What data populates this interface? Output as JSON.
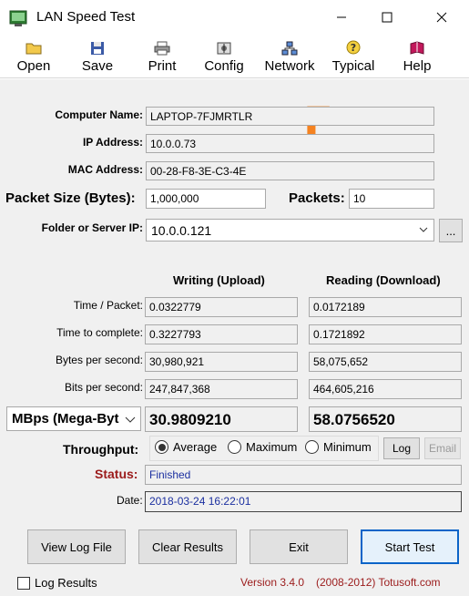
{
  "window": {
    "title": "LAN Speed Test",
    "minimize_glyph": "—",
    "maximize_glyph": "☐",
    "close_glyph": "✕"
  },
  "toolbar": [
    {
      "label": "Open",
      "icon": "open-folder-icon"
    },
    {
      "label": "Save",
      "icon": "save-disk-icon"
    },
    {
      "label": "Print",
      "icon": "printer-icon"
    },
    {
      "label": "Config",
      "icon": "config-icon"
    },
    {
      "label": "Network",
      "icon": "network-icon"
    },
    {
      "label": "Typical",
      "icon": "help-question-icon"
    },
    {
      "label": "Help",
      "icon": "help-book-icon"
    }
  ],
  "info": {
    "computer_name_label": "Computer Name:",
    "computer_name": "LAPTOP-7FJMRTLR",
    "ip_label": "IP Address:",
    "ip": "10.0.0.73",
    "mac_label": "MAC Address:",
    "mac": "00-28-F8-3E-C3-4E",
    "packet_size_label": "Packet Size (Bytes):",
    "packet_size": "1,000,000",
    "packets_label": "Packets:",
    "packets": "10",
    "folder_label": "Folder or Server IP:",
    "folder_value": "10.0.0.121",
    "browse_label": "..."
  },
  "watermark_letter": "F",
  "results": {
    "writing_header": "Writing (Upload)",
    "reading_header": "Reading (Download)",
    "rows": [
      {
        "label": "Time / Packet:",
        "write": "0.0322779",
        "read": "0.0172189"
      },
      {
        "label": "Time to complete:",
        "write": "0.3227793",
        "read": "0.1721892"
      },
      {
        "label": "Bytes per second:",
        "write": "30,980,921",
        "read": "58,075,652"
      },
      {
        "label": "Bits per second:",
        "write": "247,847,368",
        "read": "464,605,216"
      }
    ],
    "unit_select": "MBps (Mega-Byt",
    "mbps_write": "30.9809210",
    "mbps_read": "58.0756520"
  },
  "throughput": {
    "label": "Throughput:",
    "options": [
      "Average",
      "Maximum",
      "Minimum"
    ],
    "selected": "Average",
    "log_button": "Log",
    "email_button": "Email"
  },
  "status": {
    "label": "Status:",
    "value": "Finished",
    "date_label": "Date:",
    "date_value": "2018-03-24 16:22:01"
  },
  "buttons": {
    "view_log": "View Log File",
    "clear": "Clear Results",
    "exit": "Exit",
    "start": "Start Test"
  },
  "footer": {
    "log_results_label": "Log Results",
    "version": "Version 3.4.0",
    "copyright": "(2008-2012) Totusoft.com"
  },
  "colors": {
    "status_label": "#9b1b1b",
    "value_blue": "#1b2fa0",
    "version_red": "#9b1b1b",
    "watermark": "#f58220"
  }
}
